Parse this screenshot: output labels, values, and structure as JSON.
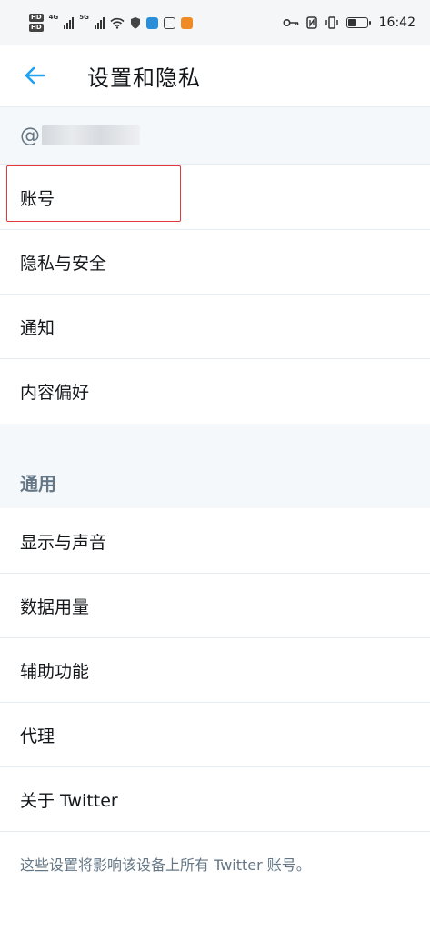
{
  "status_bar": {
    "hd1": "HD",
    "hd2": "HD",
    "net1": "4G",
    "net2": "5G",
    "time": "16:42",
    "battery_level": 0.5
  },
  "header": {
    "title": "设置和隐私"
  },
  "account": {
    "at_sign": "@"
  },
  "menu": {
    "items": [
      {
        "label": "账号"
      },
      {
        "label": "隐私与安全"
      },
      {
        "label": "通知"
      },
      {
        "label": "内容偏好"
      }
    ]
  },
  "general": {
    "section_title": "通用",
    "items": [
      {
        "label": "显示与声音"
      },
      {
        "label": "数据用量"
      },
      {
        "label": "辅助功能"
      },
      {
        "label": "代理"
      },
      {
        "label": "关于 Twitter"
      }
    ]
  },
  "footer": {
    "note": "这些设置将影响该设备上所有 Twitter 账号。"
  },
  "colors": {
    "accent": "#1da1f2",
    "highlight": "#e0383b",
    "secondary_text": "#657786"
  }
}
